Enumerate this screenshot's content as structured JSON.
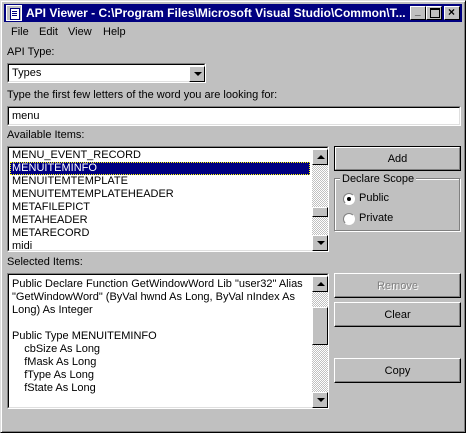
{
  "window": {
    "title": "API Viewer - C:\\Program Files\\Microsoft Visual Studio\\Common\\T...",
    "minimize_glyph": "_",
    "maximize_glyph": "□",
    "close_glyph": "×"
  },
  "menu": {
    "items": [
      {
        "label": "File"
      },
      {
        "label": "Edit"
      },
      {
        "label": "View"
      },
      {
        "label": "Help"
      }
    ]
  },
  "api_type": {
    "label": "API Type:",
    "value": "Types"
  },
  "search": {
    "label": "Type the first few letters of the word you are looking for:",
    "value": "menu"
  },
  "available": {
    "label": "Available Items:",
    "items": [
      "MENU_EVENT_RECORD",
      "MENUITEMINFO",
      "MENUITEMTEMPLATE",
      "MENUITEMTEMPLATEHEADER",
      "METAFILEPICT",
      "METAHEADER",
      "METARECORD",
      "midi"
    ],
    "selected_index": 1
  },
  "buttons": {
    "add": "Add",
    "remove": "Remove",
    "clear": "Clear",
    "copy": "Copy"
  },
  "declare_scope": {
    "title": "Declare Scope",
    "options": [
      "Public",
      "Private"
    ],
    "selected": "Public"
  },
  "selected_items": {
    "label": "Selected Items:",
    "lines": [
      "Public Declare Function GetWindowWord Lib \"user32\" Alias",
      "\"GetWindowWord\" (ByVal hwnd As Long, ByVal nIndex As",
      "Long) As Integer",
      "",
      "Public Type MENUITEMINFO",
      "    cbSize As Long",
      "    fMask As Long",
      "    fType As Long",
      "    fState As Long"
    ]
  },
  "colors": {
    "title_bar": "#000080",
    "face": "#c0c0c0",
    "selection": "#000080"
  }
}
